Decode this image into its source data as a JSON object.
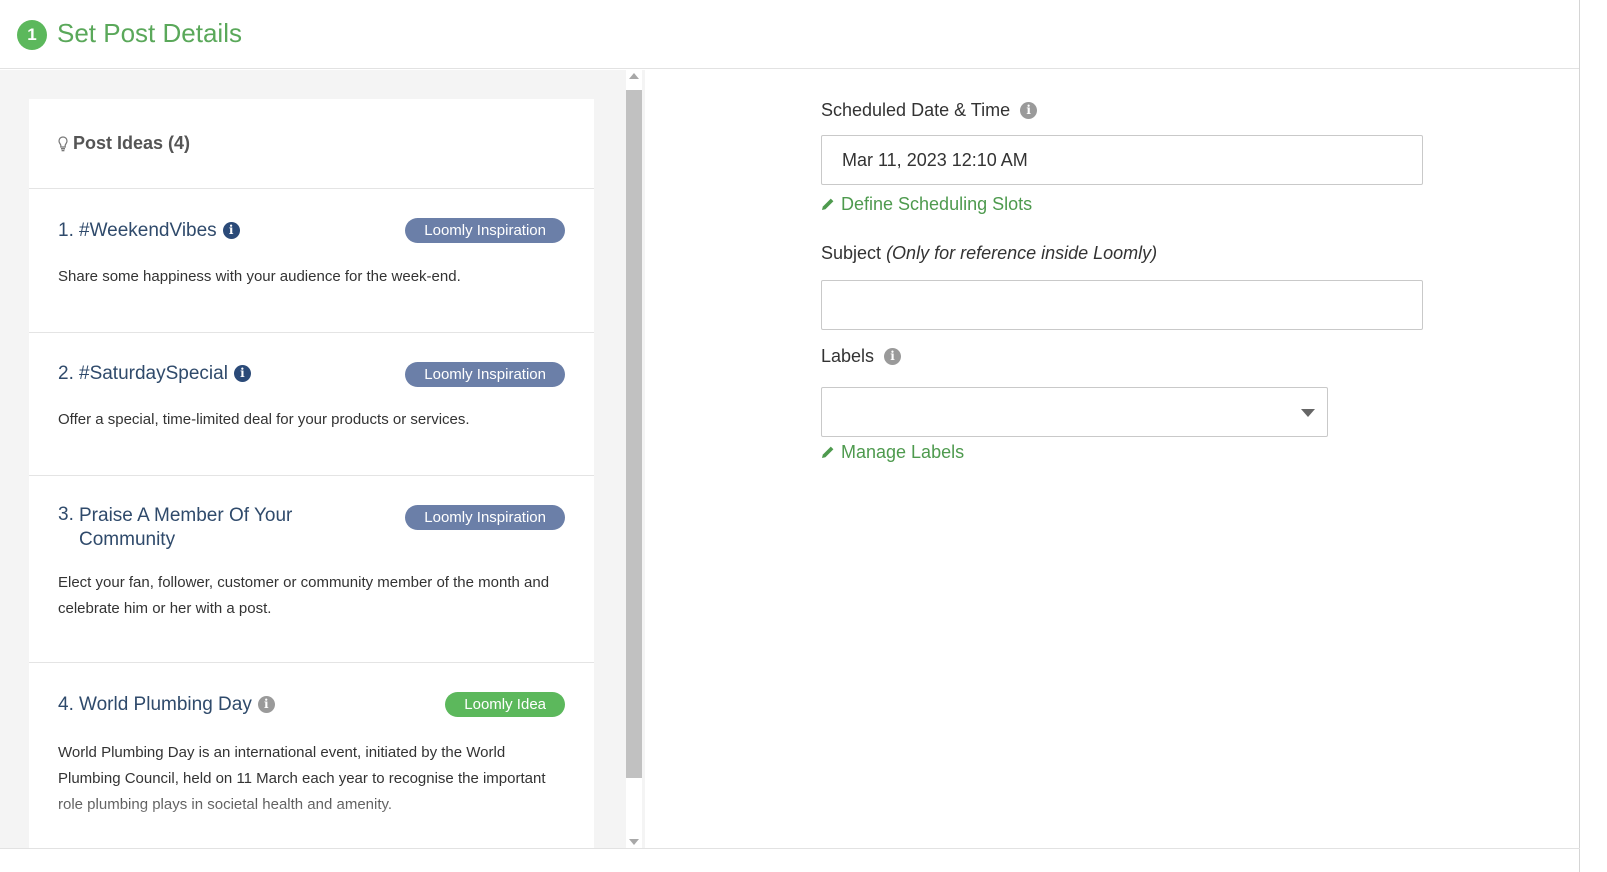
{
  "header": {
    "step_number": "1",
    "title": "Set Post Details"
  },
  "post_ideas": {
    "title": "Post Ideas (4)",
    "items": [
      {
        "number": "1.",
        "name": "#WeekendVibes",
        "badge": "Loomly Inspiration",
        "badge_color": "#6b7fa8",
        "description": "Share some happiness with your audience for the week-end."
      },
      {
        "number": "2.",
        "name": "#SaturdaySpecial",
        "badge": "Loomly Inspiration",
        "badge_color": "#6b7fa8",
        "description": "Offer a special, time-limited deal for your products or services."
      },
      {
        "number": "3.",
        "name": "Praise A Member Of Your Community",
        "badge": "Loomly Inspiration",
        "badge_color": "#6b7fa8",
        "description": "Elect your fan, follower, customer or community member of the month and celebrate him or her with a post."
      },
      {
        "number": "4.",
        "name": "World Plumbing Day",
        "badge": "Loomly Idea",
        "badge_color": "#5cb85c",
        "description": "World Plumbing Day is an international event, initiated by the World Plumbing Council, held on 11 March each year to recognise the important role plumbing plays in societal health and amenity."
      }
    ]
  },
  "form": {
    "scheduled_label": "Scheduled Date & Time",
    "scheduled_value": "Mar 11, 2023 12:10 AM",
    "define_slots_link": "Define Scheduling Slots",
    "subject_label": "Subject",
    "subject_hint": "(Only for reference inside Loomly)",
    "subject_value": "",
    "labels_label": "Labels",
    "labels_value": "",
    "manage_labels_link": "Manage Labels"
  },
  "colors": {
    "accent_green": "#5cb85c",
    "link_green": "#4e9a4e",
    "idea_title": "#2f4a6b"
  }
}
